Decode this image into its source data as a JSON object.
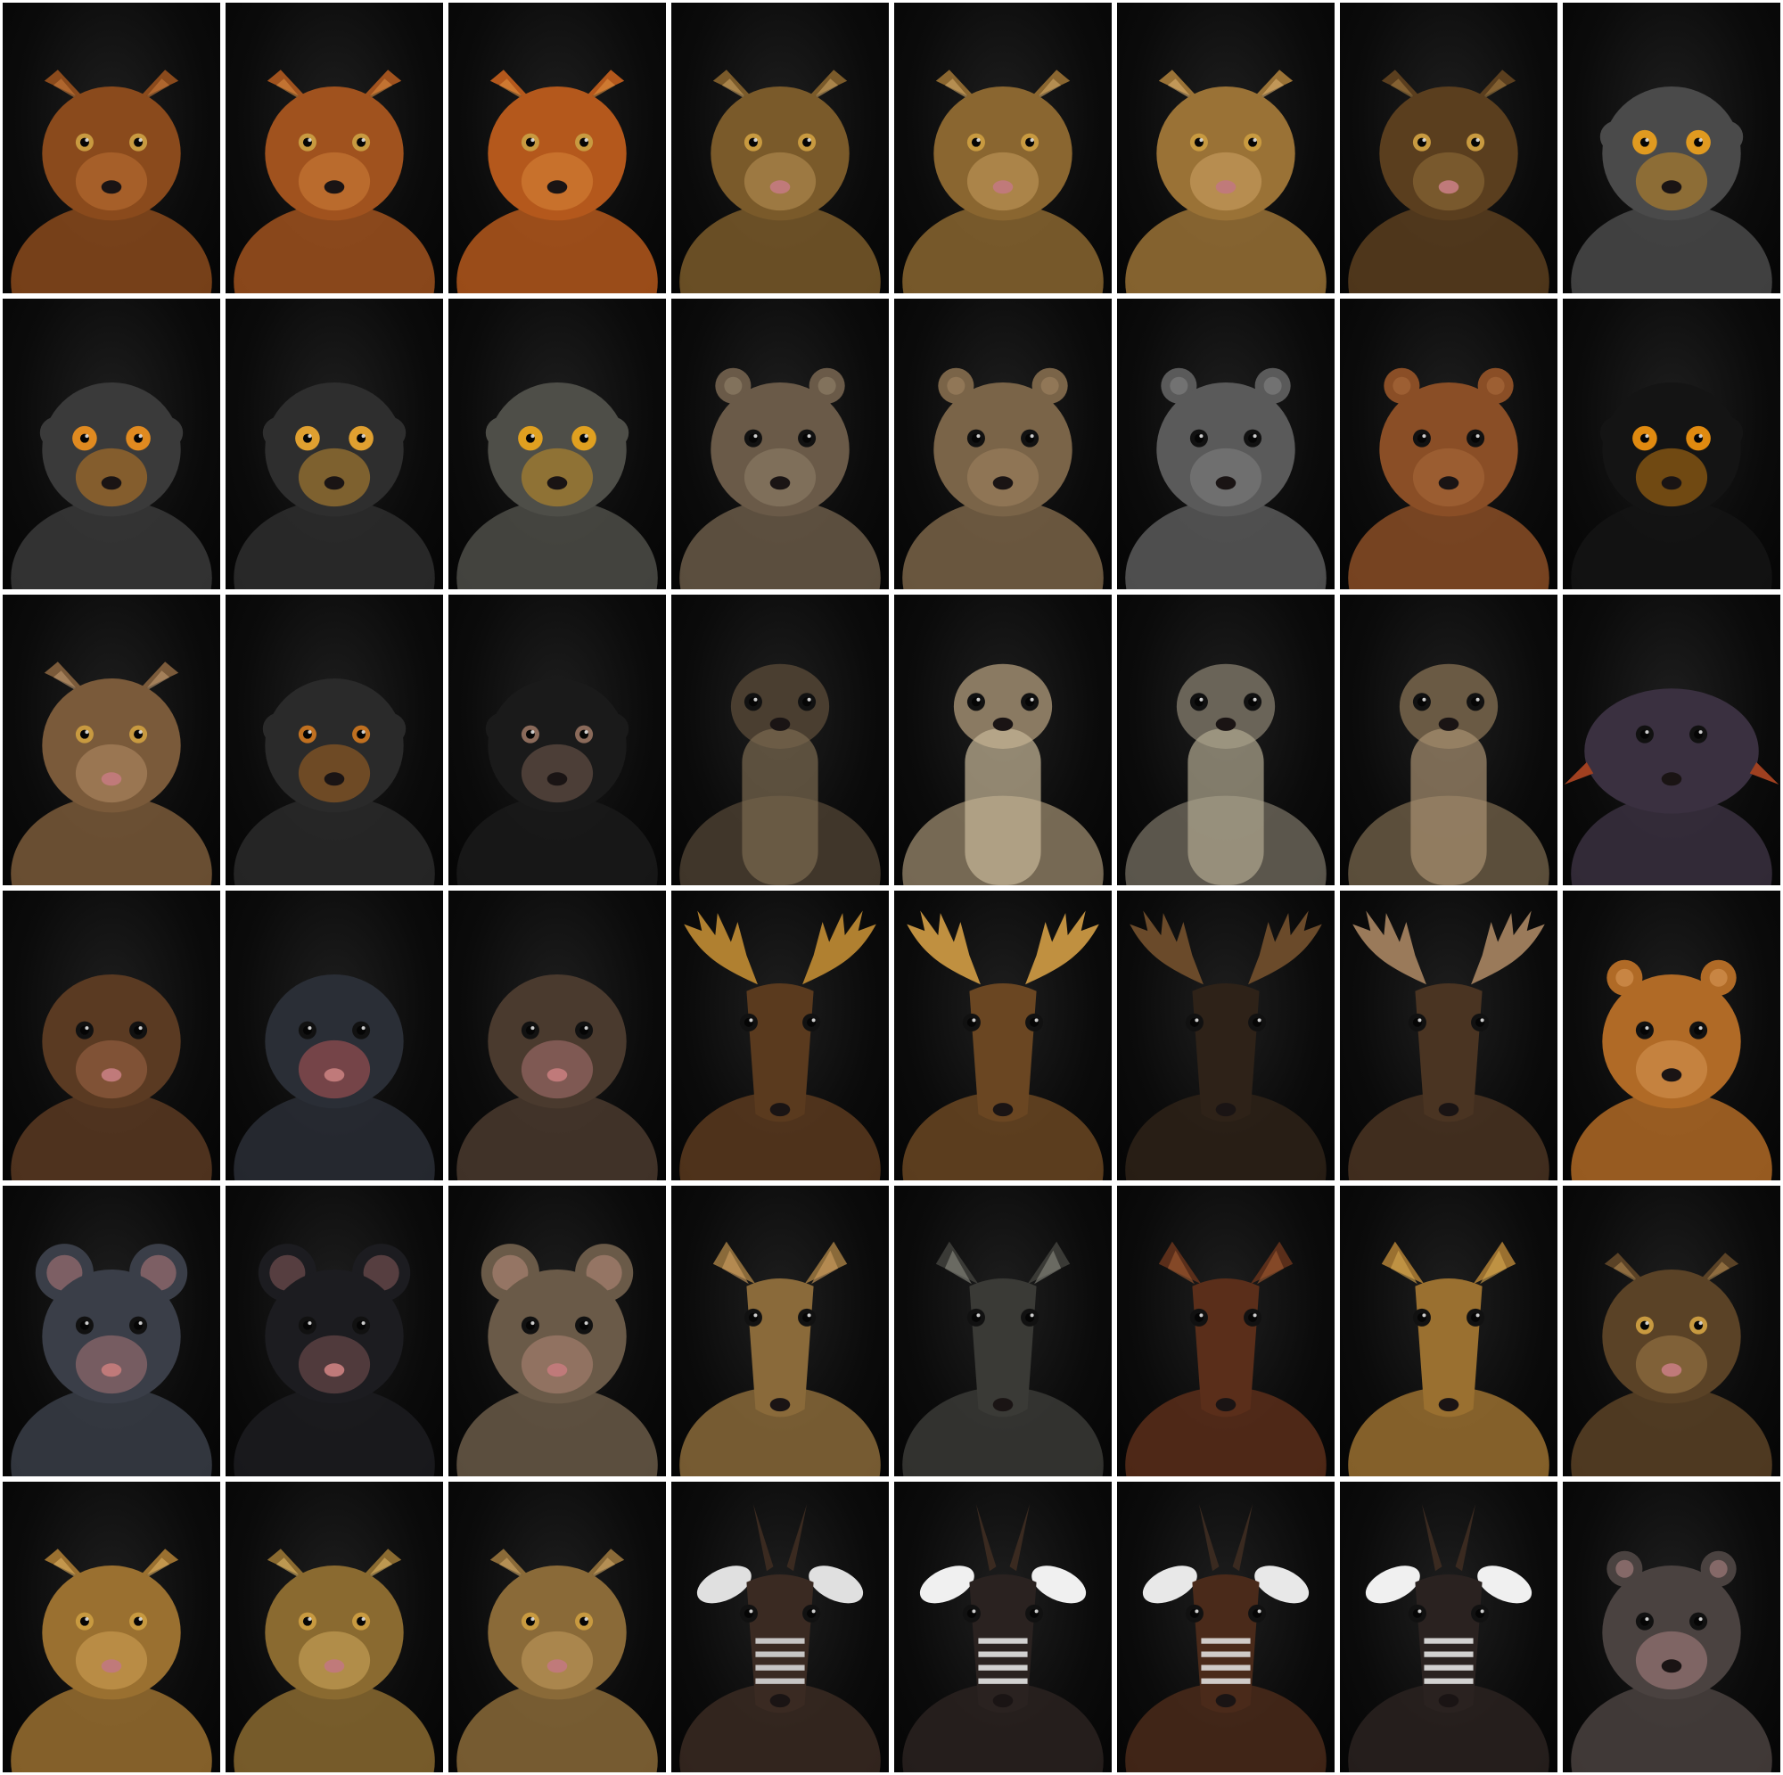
{
  "background": "#ffffff",
  "tile_background": "#0b0b0b",
  "columns": 8,
  "rows": 6,
  "tiles": [
    {
      "subject": "maned-wolf",
      "kind": "fox",
      "fur": "#8a4a1c",
      "accent": "#c87a3a"
    },
    {
      "subject": "maned-wolf",
      "kind": "fox",
      "fur": "#a0521e",
      "accent": "#d98a40"
    },
    {
      "subject": "maned-wolf",
      "kind": "fox",
      "fur": "#b4581c",
      "accent": "#e09040"
    },
    {
      "subject": "ocelot",
      "kind": "cat",
      "fur": "#7a5a2a",
      "accent": "#c8a060"
    },
    {
      "subject": "ocelot",
      "kind": "cat",
      "fur": "#8a6630",
      "accent": "#d2a868"
    },
    {
      "subject": "ocelot",
      "kind": "cat",
      "fur": "#9a7236",
      "accent": "#dcb070"
    },
    {
      "subject": "ocelot",
      "kind": "cat",
      "fur": "#5a3e1e",
      "accent": "#a07a40"
    },
    {
      "subject": "monkey",
      "kind": "monkey",
      "fur": "#4a4a4a",
      "accent": "#e09a20"
    },
    {
      "subject": "tamarin",
      "kind": "monkey",
      "fur": "#3a3a3a",
      "accent": "#e08a20"
    },
    {
      "subject": "monkey",
      "kind": "monkey",
      "fur": "#2e2e2e",
      "accent": "#e0a030"
    },
    {
      "subject": "monkey",
      "kind": "monkey",
      "fur": "#4e4e48",
      "accent": "#e0a020"
    },
    {
      "subject": "groundhog",
      "kind": "rodent",
      "fur": "#6a5a48",
      "accent": "#9a8a70"
    },
    {
      "subject": "groundhog",
      "kind": "rodent",
      "fur": "#7a6448",
      "accent": "#a88a66"
    },
    {
      "subject": "groundhog",
      "kind": "rodent",
      "fur": "#5a5a5a",
      "accent": "#8a8a8a"
    },
    {
      "subject": "groundhog",
      "kind": "rodent",
      "fur": "#8a4e26",
      "accent": "#b07040"
    },
    {
      "subject": "monkey",
      "kind": "monkey",
      "fur": "#141414",
      "accent": "#e08a10"
    },
    {
      "subject": "lynx",
      "kind": "cat",
      "fur": "#7a5a3a",
      "accent": "#c09a70"
    },
    {
      "subject": "gorilla",
      "kind": "ape",
      "fur": "#2a2a2a",
      "accent": "#c07020"
    },
    {
      "subject": "chimpanzee",
      "kind": "ape",
      "fur": "#1a1a1a",
      "accent": "#8a6a5a"
    },
    {
      "subject": "meerkat",
      "kind": "meerkat",
      "fur": "#4a3e30",
      "accent": "#7a6a50"
    },
    {
      "subject": "meerkat",
      "kind": "meerkat",
      "fur": "#8a7a62",
      "accent": "#c8b898"
    },
    {
      "subject": "meerkat",
      "kind": "meerkat",
      "fur": "#6a6458",
      "accent": "#b0a890"
    },
    {
      "subject": "meerkat",
      "kind": "meerkat",
      "fur": "#6a5a44",
      "accent": "#a89070"
    },
    {
      "subject": "fish",
      "kind": "fish",
      "fur": "#3a3040",
      "accent": "#a04020"
    },
    {
      "subject": "mole",
      "kind": "mole",
      "fur": "#5a3a22",
      "accent": "#b07050"
    },
    {
      "subject": "mole",
      "kind": "mole",
      "fur": "#2a2e36",
      "accent": "#d06060"
    },
    {
      "subject": "mole",
      "kind": "mole",
      "fur": "#4a3a2e",
      "accent": "#c08080"
    },
    {
      "subject": "moose",
      "kind": "moose",
      "fur": "#5a3a1e",
      "accent": "#b08030"
    },
    {
      "subject": "moose",
      "kind": "moose",
      "fur": "#6a4622",
      "accent": "#c09040"
    },
    {
      "subject": "moose",
      "kind": "moose",
      "fur": "#2e2218",
      "accent": "#6a4a2a"
    },
    {
      "subject": "moose",
      "kind": "moose",
      "fur": "#4a3422",
      "accent": "#9a7a5a"
    },
    {
      "subject": "hamster",
      "kind": "rodent",
      "fur": "#b06a26",
      "accent": "#e0a060"
    },
    {
      "subject": "mouse",
      "kind": "mouse",
      "fur": "#3a3e48",
      "accent": "#c08080"
    },
    {
      "subject": "rat",
      "kind": "mouse",
      "fur": "#1c1c20",
      "accent": "#906060"
    },
    {
      "subject": "mouse",
      "kind": "mouse",
      "fur": "#6a5a48",
      "accent": "#c09080"
    },
    {
      "subject": "okapi",
      "kind": "deer",
      "fur": "#8a6a3a",
      "accent": "#d0a060"
    },
    {
      "subject": "badger",
      "kind": "deer",
      "fur": "#3a3a36",
      "accent": "#8a8a80"
    },
    {
      "subject": "boar",
      "kind": "deer",
      "fur": "#5a2e1a",
      "accent": "#a05a30"
    },
    {
      "subject": "deer",
      "kind": "deer",
      "fur": "#9a7030",
      "accent": "#d8a850"
    },
    {
      "subject": "ocelot",
      "kind": "cat",
      "fur": "#5a4226",
      "accent": "#b08850"
    },
    {
      "subject": "ocelot",
      "kind": "cat",
      "fur": "#9a7030",
      "accent": "#e0b060"
    },
    {
      "subject": "ocelot",
      "kind": "cat",
      "fur": "#8a6a30",
      "accent": "#e0b868"
    },
    {
      "subject": "ocelot",
      "kind": "cat",
      "fur": "#8a6a38",
      "accent": "#d0a868"
    },
    {
      "subject": "okapi",
      "kind": "antelope",
      "fur": "#3a2a22",
      "accent": "#e0e0e0"
    },
    {
      "subject": "okapi",
      "kind": "antelope",
      "fur": "#2a2220",
      "accent": "#f0f0f0"
    },
    {
      "subject": "okapi",
      "kind": "antelope",
      "fur": "#4a2a1a",
      "accent": "#e8e8e8"
    },
    {
      "subject": "okapi",
      "kind": "antelope",
      "fur": "#2a2220",
      "accent": "#f0f0f0"
    },
    {
      "subject": "ferret",
      "kind": "rodent",
      "fur": "#4a4240",
      "accent": "#c09090"
    }
  ]
}
